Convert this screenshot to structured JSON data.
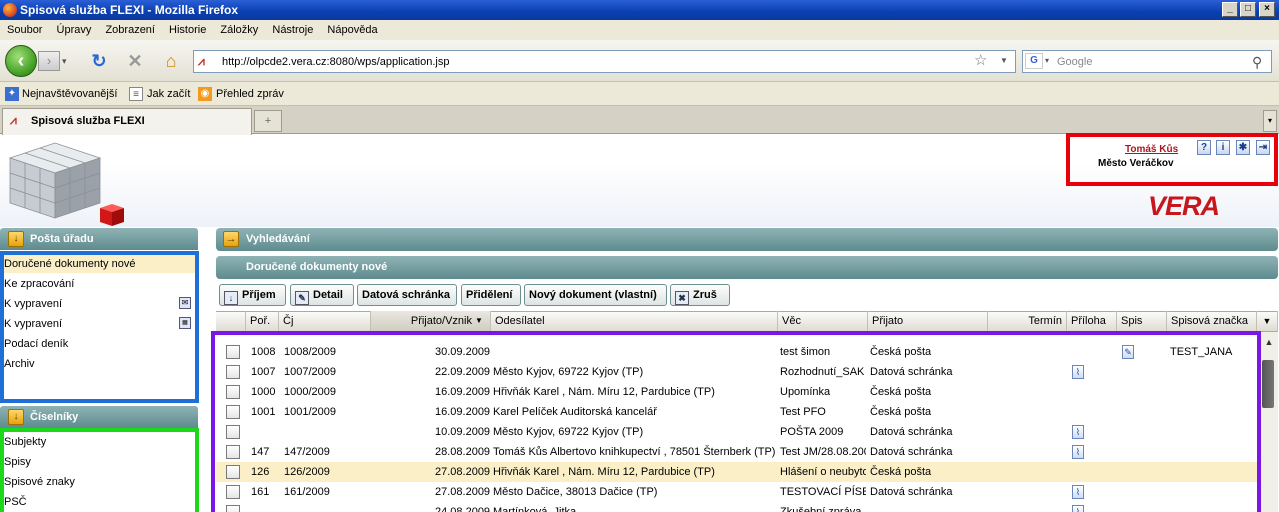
{
  "window": {
    "title": "Spisová služba FLEXI - Mozilla Firefox",
    "min": "_",
    "max": "□",
    "close": "×"
  },
  "menu": [
    "Soubor",
    "Úpravy",
    "Zobrazení",
    "Historie",
    "Záložky",
    "Nástroje",
    "Nápověda"
  ],
  "nav": {
    "url": "http://olpcde2.vera.cz:8080/wps/application.jsp",
    "search_placeholder": "Google"
  },
  "bookmarks": [
    "Nejnavštěvovanější",
    "Jak začít",
    "Přehled zpráv"
  ],
  "tabs": [
    {
      "label": "Spisová služba FLEXI"
    }
  ],
  "header": {
    "user_name": "Tomáš Kůs",
    "user_org": "Město Veráčkov",
    "logo": "VERA"
  },
  "sidebar": {
    "posta": {
      "title": "Pošta úřadu",
      "items": [
        "Doručené dokumenty nové",
        "Ke zpracování",
        "K vypravení",
        "K vypravení",
        "Podací deník",
        "Archiv"
      ]
    },
    "ciselniky": {
      "title": "Číselníky",
      "items": [
        "Subjekty",
        "Spisy",
        "Spisové znaky",
        "PSČ"
      ]
    }
  },
  "main": {
    "search_title": "Vyhledávání",
    "section_title": "Doručené dokumenty nové",
    "toolbar": {
      "prijem": "Příjem",
      "detail": "Detail",
      "datova": "Datová schránka",
      "prideleni": "Přidělení",
      "novy": "Nový dokument (vlastní)",
      "zrus": "Zruš"
    },
    "columns": {
      "por": "Poř.",
      "cj": "Čj",
      "prijato_vznik": "Přijato/Vznik",
      "odesilatel": "Odesílatel",
      "vec": "Věc",
      "prijato": "Přijato",
      "termin": "Termín",
      "priloha": "Příloha",
      "spis": "Spis",
      "spisova_znacka": "Spisová značka"
    },
    "rows": [
      {
        "por": "1008",
        "cj": "1008/2009",
        "date": "30.09.2009",
        "odesilatel": "",
        "vec": "test šimon",
        "prijato": "Česká pošta",
        "priloha": false,
        "spis": true,
        "znacka": "TEST_JANA"
      },
      {
        "por": "1007",
        "cj": "1007/2009",
        "date": "22.09.2009",
        "odesilatel": "Město Kyjov, 69722 Kyjov (TP)",
        "vec": "Rozhodnutí_SAK",
        "prijato": "Datová schránka",
        "priloha": true,
        "spis": false,
        "znacka": ""
      },
      {
        "por": "1000",
        "cj": "1000/2009",
        "date": "16.09.2009",
        "odesilatel": "Hřivňák Karel , Nám. Míru 12, Pardubice (TP)",
        "vec": "Upomínka",
        "prijato": "Česká pošta",
        "priloha": false,
        "spis": false,
        "znacka": ""
      },
      {
        "por": "1001",
        "cj": "1001/2009",
        "date": "16.09.2009",
        "odesilatel": "Karel Pelíček Auditorská kancelář",
        "vec": "Test PFO",
        "prijato": "Česká pošta",
        "priloha": false,
        "spis": false,
        "znacka": ""
      },
      {
        "por": "",
        "cj": "",
        "date": "10.09.2009",
        "odesilatel": "Město Kyjov, 69722 Kyjov (TP)",
        "vec": "POŠTA 2009",
        "prijato": "Datová schránka",
        "priloha": true,
        "spis": false,
        "znacka": ""
      },
      {
        "por": "147",
        "cj": "147/2009",
        "date": "28.08.2009",
        "odesilatel": "Tomáš Kůs Albertovo knihkupectví , 78501 Šternberk (TP)",
        "vec": "Test JM/28.08.200",
        "prijato": "Datová schránka",
        "priloha": true,
        "spis": false,
        "znacka": ""
      },
      {
        "por": "126",
        "cj": "126/2009",
        "date": "27.08.2009",
        "odesilatel": "Hřivňák Karel , Nám. Míru 12, Pardubice (TP)",
        "vec": "Hlášení o neubyto",
        "prijato": "Česká pošta",
        "priloha": false,
        "spis": false,
        "znacka": ""
      },
      {
        "por": "161",
        "cj": "161/2009",
        "date": "27.08.2009",
        "odesilatel": "Město Dačice, 38013 Dačice (TP)",
        "vec": "TESTOVACÍ PÍSEM",
        "prijato": "Datová schránka",
        "priloha": true,
        "spis": false,
        "znacka": ""
      },
      {
        "por": "",
        "cj": "",
        "date": "24.08.2009",
        "odesilatel": "Martínková, Jitka",
        "vec": "Zkušební zpráva",
        "prijato": "",
        "priloha": true,
        "spis": false,
        "znacka": ""
      }
    ]
  },
  "colors": {
    "highlight_red": "#e8000b",
    "highlight_blue": "#1e6fd8",
    "highlight_green": "#1ad81a",
    "highlight_purple": "#7a17e6",
    "selected_row": "#fbefc8"
  }
}
